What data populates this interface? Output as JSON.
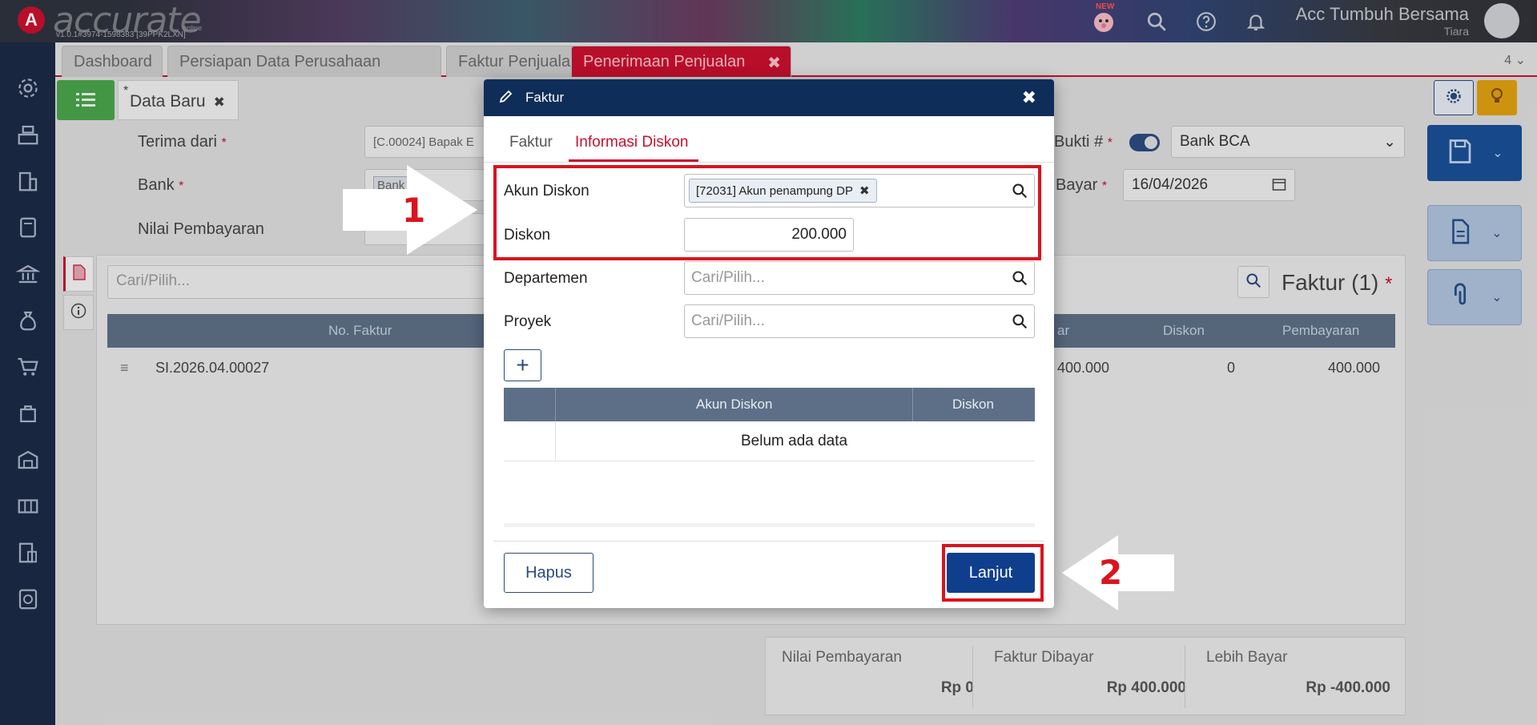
{
  "app": {
    "logo_letter": "A",
    "logo_text": "accurate",
    "logo_sub": "online",
    "version": "v1.0.1#3974-1598383 [39PPK2LXN]",
    "new_badge": "NEW",
    "company": "Acc Tumbuh Bersama",
    "user": "Tiara"
  },
  "tabs": [
    {
      "label": "Dashboard"
    },
    {
      "label": "Persiapan Data Perusahaan"
    },
    {
      "label": "Faktur Penjualan",
      "close": "✖"
    },
    {
      "label": "Penerimaan Penjualan",
      "close": "✖"
    }
  ],
  "tab_count": "4",
  "subtab": {
    "marker": "*",
    "label": "Data Baru",
    "close": "✖"
  },
  "form": {
    "terima_dari_label": "Terima dari",
    "terima_dari_value": "[C.00024] Bapak E",
    "bank_label": "Bank",
    "bank_value": "Bank",
    "bank_chip_close": "✖",
    "nilai_label": "Nilai Pembayaran",
    "bukti_label": "Bukti #",
    "bukti_value": "Bank BCA",
    "tgl_label": "l Bayar",
    "tgl_value": "16/04/2026",
    "required_mark": "*"
  },
  "panel": {
    "search_placeholder": "Cari/Pilih...",
    "title": "Faktur (1)",
    "headers": {
      "no_faktur": "No. Faktur",
      "ar": "ar",
      "diskon": "Diskon",
      "pembayaran": "Pembayaran"
    },
    "row": {
      "handle": "≡",
      "no_faktur": "SI.2026.04.00027",
      "ar": "400.000",
      "diskon": "0",
      "pembayaran": "400.000"
    }
  },
  "summary": [
    {
      "label": "Nilai Pembayaran",
      "value": "Rp 0"
    },
    {
      "label": "Faktur Dibayar",
      "value": "Rp 400.000"
    },
    {
      "label": "Lebih Bayar",
      "value": "Rp -400.000"
    }
  ],
  "modal": {
    "title": "Faktur",
    "close": "✖",
    "tabs": [
      "Faktur",
      "Informasi Diskon"
    ],
    "akun_diskon_label": "Akun Diskon",
    "akun_diskon_chip": "[72031] Akun penampung DP",
    "chip_close": "✖",
    "diskon_label": "Diskon",
    "diskon_value": "200.000",
    "departemen_label": "Departemen",
    "proyek_label": "Proyek",
    "placeholder": "Cari/Pilih...",
    "add_label": "+",
    "table_headers": [
      "Akun Diskon",
      "Diskon"
    ],
    "empty_text": "Belum ada data",
    "hapus_label": "Hapus",
    "lanjut_label": "Lanjut"
  },
  "annotations": {
    "step1": "1",
    "step2": "2",
    "color": "#d9141f"
  },
  "colors": {
    "brand_red": "#c8102e",
    "navy": "#0f2d59",
    "sidebar": "#1c2a45",
    "grid_header": "#5d6f86"
  }
}
